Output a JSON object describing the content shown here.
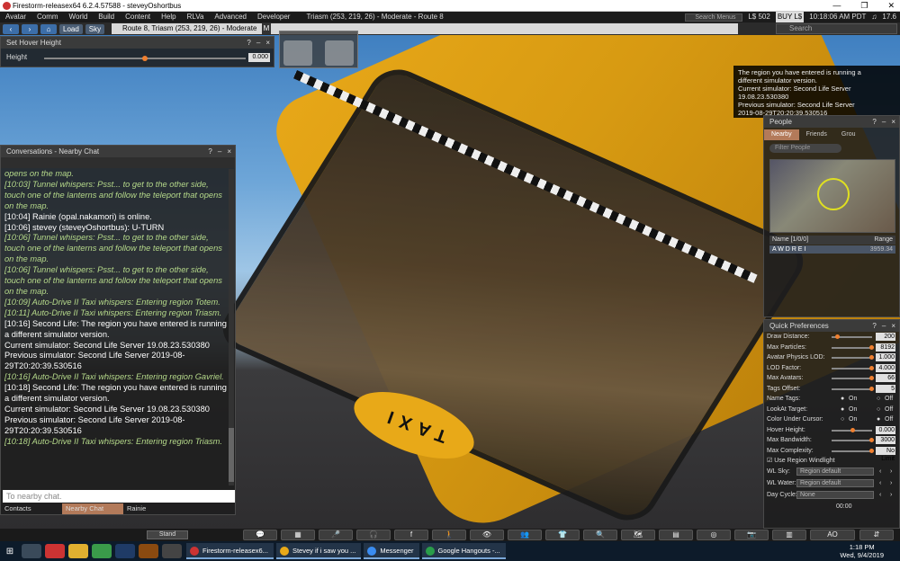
{
  "window": {
    "title": "Firestorm-releasex64 6.2.4.57588 - steveyOshortbus",
    "controls": [
      "—",
      "❐",
      "✕"
    ]
  },
  "menubar": {
    "items": [
      "Avatar",
      "Comm",
      "World",
      "Build",
      "Content",
      "Help",
      "RLVa",
      "Advanced",
      "Developer"
    ],
    "region_status": "Triasm (253, 219, 26) - Moderate - Route 8",
    "search_placeholder": "Search Menus",
    "balance": "L$ 502",
    "buy_label": "BUY L$",
    "time": "10:18:06 AM PDT",
    "fps": "17.6"
  },
  "navbar": {
    "back": "‹",
    "forward": "›",
    "home": "⌂",
    "load_label": "Load",
    "sky_label": "Sky",
    "location": "Route 8, Triasm (253, 219, 26) - Moderate",
    "maturity_badge": "M",
    "search_placeholder": "Search"
  },
  "hover_height": {
    "title": "Set Hover Height",
    "label": "Height",
    "value": "0.000",
    "slider_fraction": 0.5
  },
  "toast": {
    "lines": [
      "The region you have entered is running a",
      "different simulator version.",
      "Current simulator: Second Life Server",
      "19.08.23.530380",
      "Previous simulator: Second Life Server",
      "2019-08-29T20:20:39.530516"
    ]
  },
  "people": {
    "title": "People",
    "tabs": [
      "Nearby",
      "Friends",
      "Grou"
    ],
    "active_tab": 0,
    "filter_placeholder": "Filter People",
    "columns": {
      "name": "Name [1/0/0]",
      "range": "Range"
    },
    "rows": [
      {
        "name": "A W D R E I",
        "range": "3959.34"
      }
    ]
  },
  "quick_prefs": {
    "title": "Quick Preferences",
    "sliders": [
      {
        "label": "Draw Distance:",
        "value": "200",
        "fraction": 0.1
      },
      {
        "label": "Max Particles:",
        "value": "8192",
        "fraction": 1.0
      },
      {
        "label": "Avatar Physics LOD:",
        "value": "1.000",
        "fraction": 1.0
      },
      {
        "label": "LOD Factor:",
        "value": "4.000",
        "fraction": 1.0
      },
      {
        "label": "Max Avatars:",
        "value": "66",
        "fraction": 1.0
      },
      {
        "label": "Tags Offset:",
        "value": "5",
        "fraction": 1.0
      }
    ],
    "radios": [
      {
        "label": "Name Tags:",
        "on": "On",
        "off": "Off",
        "selected": "on"
      },
      {
        "label": "LookAt Target:",
        "on": "On",
        "off": "Off",
        "selected": "on"
      },
      {
        "label": "Color Under Cursor:",
        "on": "On",
        "off": "Off",
        "selected": "off"
      }
    ],
    "sliders2": [
      {
        "label": "Hover Height:",
        "value": "0.000",
        "fraction": 0.5
      },
      {
        "label": "Max Bandwidth:",
        "value": "3000",
        "fraction": 1.0
      },
      {
        "label": "Max Complexity:",
        "value": "No Limit",
        "fraction": 1.0
      }
    ],
    "windlight_checkbox": "Use Region Windlight",
    "dropdowns": [
      {
        "label": "WL Sky:",
        "value": "Region default"
      },
      {
        "label": "WL Water:",
        "value": "Region default"
      },
      {
        "label": "Day Cycle:",
        "value": "None"
      }
    ],
    "day_time": "00:00"
  },
  "conversations": {
    "title": "Conversations - Nearby Chat",
    "lines": [
      {
        "kind": "whisper",
        "text": "opens on the map."
      },
      {
        "kind": "whisper",
        "text": "[10:03] Tunnel  whispers: Psst... to get to the other side, touch one of the lanterns and follow the teleport that opens on the map."
      },
      {
        "kind": "online",
        "text": "[10:04] Rainie (opal.nakamori) is online."
      },
      {
        "kind": "sys",
        "text": "[10:06] stevey (steveyOshortbus): U-TURN"
      },
      {
        "kind": "whisper",
        "text": "[10:06] Tunnel  whispers: Psst... to get to the other side, touch one of the lanterns and follow the teleport that opens on the map."
      },
      {
        "kind": "whisper",
        "text": "[10:06] Tunnel  whispers: Psst... to get to the other side, touch one of the lanterns and follow the teleport that opens on the map."
      },
      {
        "kind": "whisper",
        "text": "[10:09] Auto-Drive II Taxi whispers: Entering region Totem."
      },
      {
        "kind": "whisper",
        "text": "[10:11] Auto-Drive II Taxi whispers: Entering region Triasm."
      },
      {
        "kind": "sys",
        "text": "[10:16] Second Life: The region you have entered is running a different simulator version."
      },
      {
        "kind": "sys",
        "text": "Current simulator: Second Life Server 19.08.23.530380"
      },
      {
        "kind": "sys",
        "text": "Previous simulator: Second Life Server 2019-08-29T20:20:39.530516"
      },
      {
        "kind": "whisper",
        "text": "[10:16] Auto-Drive II Taxi whispers: Entering region Gavriel."
      },
      {
        "kind": "sys",
        "text": "[10:18] Second Life: The region you have entered is running a different simulator version."
      },
      {
        "kind": "sys",
        "text": "Current simulator: Second Life Server 19.08.23.530380"
      },
      {
        "kind": "sys",
        "text": "Previous simulator: Second Life Server 2019-08-29T20:20:39.530516"
      },
      {
        "kind": "whisper",
        "text": "[10:18] Auto-Drive II Taxi whispers: Entering region Triasm."
      }
    ],
    "input_placeholder": "To nearby chat.",
    "tabs": [
      "Contacts",
      "Nearby Chat",
      "Rainie"
    ],
    "active_tab": 1
  },
  "scene": {
    "sign_text": "TAXI"
  },
  "bottom_toolbar": {
    "stand_label": "Stand",
    "ao_label": "AO"
  },
  "taskbar": {
    "apps": [
      {
        "label": "Firestorm-releasex6...",
        "color": "#c33"
      },
      {
        "label": "Stevey if i saw you ...",
        "color": "#e8a918"
      },
      {
        "label": "Messenger",
        "color": "#3a8cf0"
      },
      {
        "label": "Google Hangouts -...",
        "color": "#2a9d4a"
      }
    ],
    "time": "1:18 PM",
    "date": "Wed, 9/4/2019"
  }
}
